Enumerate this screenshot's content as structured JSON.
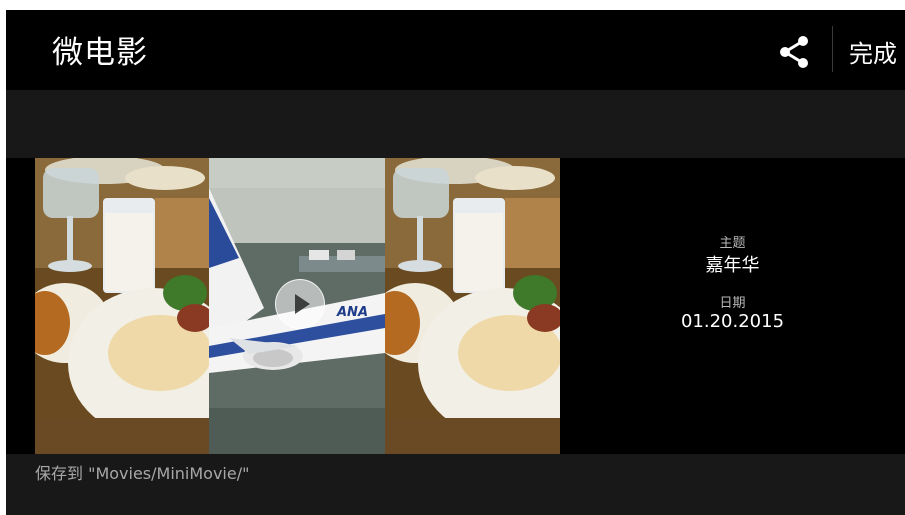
{
  "header": {
    "title": "微电影",
    "done_label": "完成",
    "share_icon": "share-icon"
  },
  "info": {
    "theme_label": "主题",
    "theme_value": "嘉年华",
    "date_label": "日期",
    "date_value": "01.20.2015"
  },
  "preview": {
    "tiles": [
      "breakfast-photo",
      "airplane-photo",
      "breakfast-photo"
    ],
    "play_icon": "play-icon"
  },
  "footer": {
    "save_path": "保存到 \"Movies/MiniMovie/\""
  },
  "colors": {
    "background": "#000000",
    "strip": "#181818",
    "text": "#ffffff",
    "muted": "#a7a7a7"
  }
}
